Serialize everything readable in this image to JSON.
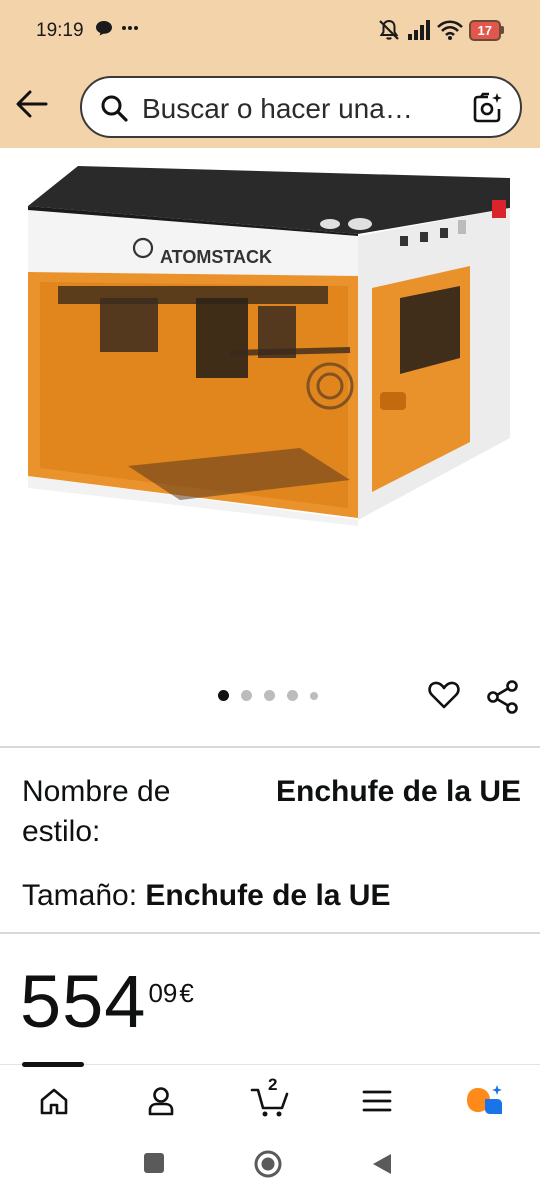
{
  "status_bar": {
    "time": "19:19",
    "battery": "17"
  },
  "search": {
    "placeholder": "Buscar o hacer una…"
  },
  "product": {
    "brand_on_image": "ATOMSTACK"
  },
  "carousel": {
    "total_images": 5,
    "active_index": 0
  },
  "style": {
    "label": "Nombre de estilo:",
    "value": "Enchufe de la UE"
  },
  "size": {
    "label": "Tamaño:",
    "value": "Enchufe de la UE"
  },
  "price": {
    "whole": "554",
    "fraction": "09",
    "currency": "€"
  },
  "bottom_nav": {
    "cart_count": "2",
    "items": [
      "home-icon",
      "account-icon",
      "cart-icon",
      "menu-icon",
      "rufus-assistant-icon"
    ]
  },
  "colors": {
    "header_bg": "#f3d3a9",
    "acrylic_orange": "#e8891a",
    "assistant_orange": "#ff8a1a",
    "assistant_blue": "#1a73e8"
  }
}
